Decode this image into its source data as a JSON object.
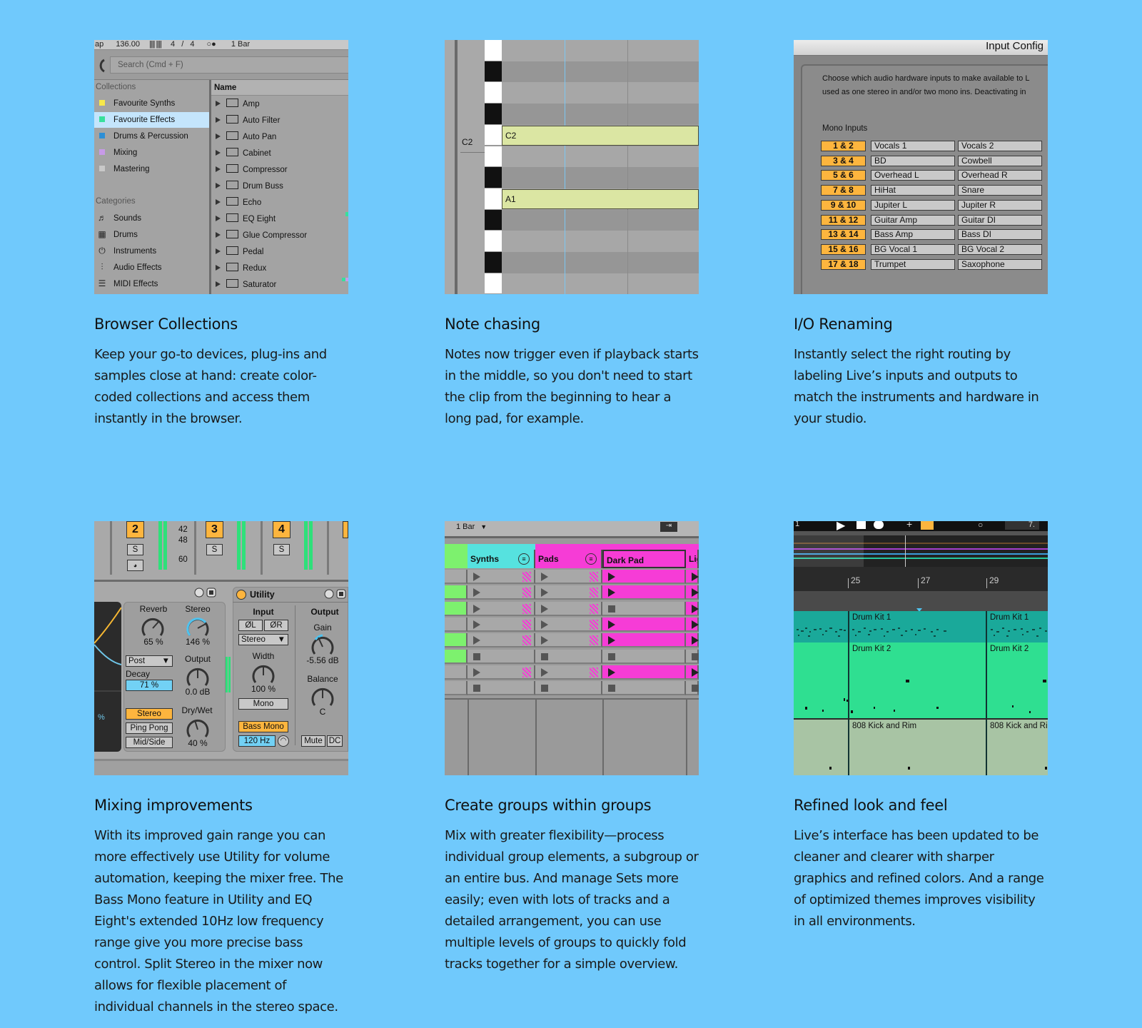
{
  "cards": [
    {
      "title": "Browser Collections",
      "text": "Keep your go-to devices, plug-ins and samples close at hand: create color-coded collections and access them instantly in the browser."
    },
    {
      "title": "Note chasing",
      "text": "Notes now trigger even if playback starts in the middle, so you don't need to start the clip from the beginning to hear a long pad, for example."
    },
    {
      "title": "I/O Renaming",
      "text": "Instantly select the right routing by labeling Live’s inputs and outputs to match the instruments and hardware in your studio."
    },
    {
      "title": "Mixing improvements",
      "text": "With its improved gain range you can more effectively use Utility for volume automation, keeping the mixer free. The Bass Mono feature in Utility and EQ Eight's extended 10Hz low frequency range give you more precise bass control. Split Stereo in the mixer now allows for flexible placement of individual channels in the stereo space."
    },
    {
      "title": "Create groups within groups",
      "text": "Mix with greater flexibility—process individual group elements, a subgroup or an entire bus. And manage Sets more easily; even with lots of tracks and a detailed arrangement, you can use multiple levels of groups to quickly fold tracks together for a simple overview."
    },
    {
      "title": "Refined look and feel",
      "text": "Live’s interface has been updated to be cleaner and clearer with sharper graphics and refined colors. And a range of optimized themes improves visibility in all environments."
    }
  ],
  "browser": {
    "topbar": [
      "ap",
      "136.00",
      "4",
      "/",
      "4",
      "1 Bar"
    ],
    "search_placeholder": "Search (Cmd + F)",
    "collections_heading": "Collections",
    "collections": [
      {
        "label": "Favourite Synths",
        "color": "#f7e84a"
      },
      {
        "label": "Favourite Effects",
        "color": "#38e09c"
      },
      {
        "label": "Drums & Percussion",
        "color": "#2d8fd6"
      },
      {
        "label": "Mixing",
        "color": "#c79ae8"
      },
      {
        "label": "Mastering",
        "color": "#c8c8c8"
      }
    ],
    "categories_heading": "Categories",
    "categories": [
      {
        "label": "Sounds",
        "icon": "♬"
      },
      {
        "label": "Drums",
        "icon": "▦"
      },
      {
        "label": "Instruments",
        "icon": "⏻"
      },
      {
        "label": "Audio Effects",
        "icon": "⫶"
      },
      {
        "label": "MIDI Effects",
        "icon": "☰"
      }
    ],
    "name_header": "Name",
    "items": [
      "Amp",
      "Auto Filter",
      "Auto Pan",
      "Cabinet",
      "Compressor",
      "Drum Buss",
      "Echo",
      "EQ Eight",
      "Glue Compressor",
      "Pedal",
      "Redux",
      "Saturator"
    ]
  },
  "notechase": {
    "row_label": "C2",
    "notes": [
      "C2",
      "A1"
    ]
  },
  "io": {
    "window_title": "Input Config",
    "description_line1": "Choose which audio hardware inputs to make available to L",
    "description_line2": "used as one stereo in and/or two mono ins.  Deactivating in",
    "section": "Mono Inputs",
    "rows": [
      {
        "num": "1 & 2",
        "a": "Vocals 1",
        "b": "Vocals 2"
      },
      {
        "num": "3 & 4",
        "a": "BD",
        "b": "Cowbell"
      },
      {
        "num": "5 & 6",
        "a": "Overhead L",
        "b": "Overhead R"
      },
      {
        "num": "7 & 8",
        "a": "HiHat",
        "b": "Snare"
      },
      {
        "num": "9 & 10",
        "a": "Jupiter L",
        "b": "Jupiter R"
      },
      {
        "num": "11 & 12",
        "a": "Guitar Amp",
        "b": "Guitar DI"
      },
      {
        "num": "13 & 14",
        "a": "Bass Amp",
        "b": "Bass DI"
      },
      {
        "num": "15 & 16",
        "a": "BG Vocal 1",
        "b": "BG Vocal 2"
      },
      {
        "num": "17 & 18",
        "a": "Trumpet",
        "b": "Saxophone"
      }
    ]
  },
  "mixing": {
    "tracks": [
      "2",
      "3",
      "4"
    ],
    "solo": "S",
    "meter_ticks": [
      "42",
      "48",
      "60"
    ],
    "reverb": {
      "reverb_label": "Reverb",
      "reverb_value": "65 %",
      "stereo_label": "Stereo",
      "stereo_value": "146 %",
      "post": "Post",
      "decay_label": "Decay",
      "decay_value": "71 %",
      "output_label": "Output",
      "output_value": "0.0 dB",
      "modes": [
        "Stereo",
        "Ping Pong",
        "Mid/Side"
      ],
      "drywet_label": "Dry/Wet",
      "drywet_value": "40 %",
      "pct": "%"
    },
    "utility": {
      "title": "Utility",
      "input_label": "Input",
      "output_label": "Output",
      "phase_l": "ØL",
      "phase_r": "ØR",
      "stereo_select": "Stereo",
      "gain_label": "Gain",
      "gain_value": "-5.56 dB",
      "width_label": "Width",
      "width_value": "100 %",
      "mono": "Mono",
      "balance_label": "Balance",
      "balance_value": "C",
      "bass_mono": "Bass Mono",
      "freq": "120 Hz",
      "mute": "Mute",
      "dc": "DC"
    }
  },
  "groups": {
    "quantize": "1 Bar",
    "columns": [
      "Synths",
      "Pads",
      "Dark Pad",
      "Lig"
    ]
  },
  "arrangement": {
    "bars": [
      "25",
      "27",
      "29"
    ],
    "left_bar": "1",
    "right_num": "7.",
    "clips": [
      "Drum Kit 1",
      "Drum Kit 1",
      "Drum Kit 2",
      "Drum Kit 2",
      "808 Kick and Rim",
      "808 Kick and Ri"
    ]
  }
}
